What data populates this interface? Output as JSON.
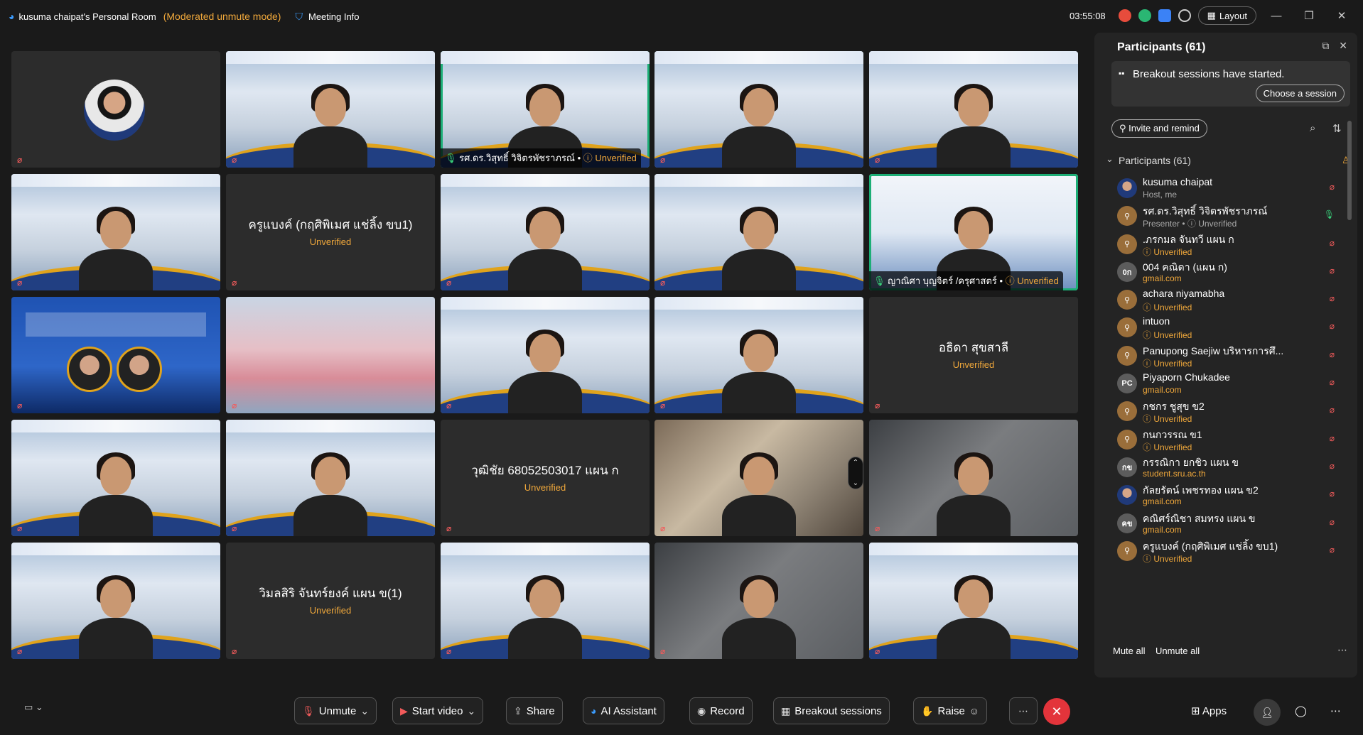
{
  "topbar": {
    "room_title": "kusuma chaipat's Personal Room",
    "mode": "(Moderated unmute mode)",
    "meeting_info": "Meeting Info",
    "timer": "03:55:08",
    "layout_label": "Layout"
  },
  "tiles": [
    {
      "kind": "avatar",
      "name": "",
      "unverified": ""
    },
    {
      "kind": "video",
      "name": "",
      "unverified": ""
    },
    {
      "kind": "video-active",
      "name": "รศ.ดร.วิสุทธิ์ วิจิตรพัชราภรณ์ •",
      "unverified": "Unverified"
    },
    {
      "kind": "video",
      "name": "",
      "unverified": ""
    },
    {
      "kind": "video",
      "name": "",
      "unverified": ""
    },
    {
      "kind": "video",
      "name": "",
      "unverified": ""
    },
    {
      "kind": "blank",
      "name": "ครูแบงค์ (กฤศิพิเมศ แช่ลิ้ง ขบ1)",
      "unverified": "Unverified"
    },
    {
      "kind": "video",
      "name": "",
      "unverified": ""
    },
    {
      "kind": "video",
      "name": "",
      "unverified": ""
    },
    {
      "kind": "edu-active",
      "name": "ญาณิศา บุญจิตร์ /ครุศาสตร์ •",
      "unverified": "Unverified"
    },
    {
      "kind": "poster",
      "name": "",
      "unverified": ""
    },
    {
      "kind": "pink",
      "name": "",
      "unverified": ""
    },
    {
      "kind": "video",
      "name": "",
      "unverified": ""
    },
    {
      "kind": "video",
      "name": "",
      "unverified": ""
    },
    {
      "kind": "blank",
      "name": "อธิดา  สุขสาลี",
      "unverified": "Unverified"
    },
    {
      "kind": "video",
      "name": "",
      "unverified": ""
    },
    {
      "kind": "video",
      "name": "",
      "unverified": ""
    },
    {
      "kind": "blank",
      "name": "วุฒิชัย 68052503017 แผน ก",
      "unverified": "Unverified"
    },
    {
      "kind": "room",
      "name": "",
      "unverified": ""
    },
    {
      "kind": "room2",
      "name": "",
      "unverified": ""
    },
    {
      "kind": "video",
      "name": "",
      "unverified": ""
    },
    {
      "kind": "blank",
      "name": "วิมลสิริ จันทร์ยงค์ แผน ข(1)",
      "unverified": "Unverified"
    },
    {
      "kind": "video",
      "name": "",
      "unverified": ""
    },
    {
      "kind": "room2",
      "name": "",
      "unverified": ""
    },
    {
      "kind": "video",
      "name": "",
      "unverified": ""
    }
  ],
  "panel": {
    "title": "Participants (61)",
    "breakout_text": "Breakout sessions have started.",
    "choose_session": "Choose a session",
    "invite": "Invite and remind",
    "section_header": "Participants (61)",
    "participants": [
      {
        "name": "kusuma chaipat",
        "sub": "Host, me",
        "sub_kind": "plain",
        "avatar": "photo",
        "initials": "",
        "mic": "muted"
      },
      {
        "name": "รศ.ดร.วิสุทธิ์ วิจิตรพัชราภรณ์",
        "sub": "Presenter • ⓘ Unverified",
        "sub_kind": "mixed",
        "avatar": "person",
        "initials": "",
        "mic": "on"
      },
      {
        "name": ".ภรกมล จันทวี แผน ก",
        "sub": "ⓘ Unverified",
        "sub_kind": "uv",
        "avatar": "person",
        "initials": "",
        "mic": "muted"
      },
      {
        "name": "004 คณิดา (แผน ก)",
        "sub": "gmail.com",
        "sub_kind": "mail",
        "avatar": "gray",
        "initials": "0ก",
        "mic": "muted"
      },
      {
        "name": "achara niyamabha",
        "sub": "ⓘ Unverified",
        "sub_kind": "uv",
        "avatar": "person",
        "initials": "",
        "mic": "muted"
      },
      {
        "name": "intuon",
        "sub": "ⓘ Unverified",
        "sub_kind": "uv",
        "avatar": "person",
        "initials": "",
        "mic": "muted"
      },
      {
        "name": "Panupong Saejiw บริหารการศึ...",
        "sub": "ⓘ Unverified",
        "sub_kind": "uv",
        "avatar": "person",
        "initials": "",
        "mic": "muted"
      },
      {
        "name": "Piyaporn Chukadee",
        "sub": "gmail.com",
        "sub_kind": "mail",
        "avatar": "gray",
        "initials": "PC",
        "mic": "muted"
      },
      {
        "name": "กชกร ชูสุข ข2",
        "sub": "ⓘ Unverified",
        "sub_kind": "uv",
        "avatar": "person",
        "initials": "",
        "mic": "muted"
      },
      {
        "name": "กนกวรรณ ข1",
        "sub": "ⓘ Unverified",
        "sub_kind": "uv",
        "avatar": "person",
        "initials": "",
        "mic": "muted"
      },
      {
        "name": "กรรณิกา ยกชิว แผน ข",
        "sub": "student.sru.ac.th",
        "sub_kind": "mail",
        "avatar": "gray",
        "initials": "กข",
        "mic": "muted"
      },
      {
        "name": "กัลยรัตน์ เพชรทอง แผน ข2",
        "sub": "gmail.com",
        "sub_kind": "mail",
        "avatar": "photo",
        "initials": "",
        "mic": "muted"
      },
      {
        "name": "คณิศร์ณิชา สมทรง แผน ข",
        "sub": "gmail.com",
        "sub_kind": "mail",
        "avatar": "gray",
        "initials": "คข",
        "mic": "muted"
      },
      {
        "name": "ครูแบงค์ (กฤศิพิเมศ แช่ลิ้ง ขบ1)",
        "sub": "ⓘ Unverified",
        "sub_kind": "uv",
        "avatar": "person",
        "initials": "",
        "mic": "muted"
      }
    ],
    "mute_all": "Mute all",
    "unmute_all": "Unmute all"
  },
  "bottombar": {
    "unmute": "Unmute",
    "start_video": "Start video",
    "share": "Share",
    "ai_assistant": "AI Assistant",
    "record": "Record",
    "breakout": "Breakout sessions",
    "raise": "Raise",
    "apps": "Apps"
  },
  "colors": {
    "accent_unverified": "#f0a83b",
    "active_speaker": "#1cae76",
    "end_call": "#e3343b",
    "muted_mic": "#f25b5b"
  }
}
